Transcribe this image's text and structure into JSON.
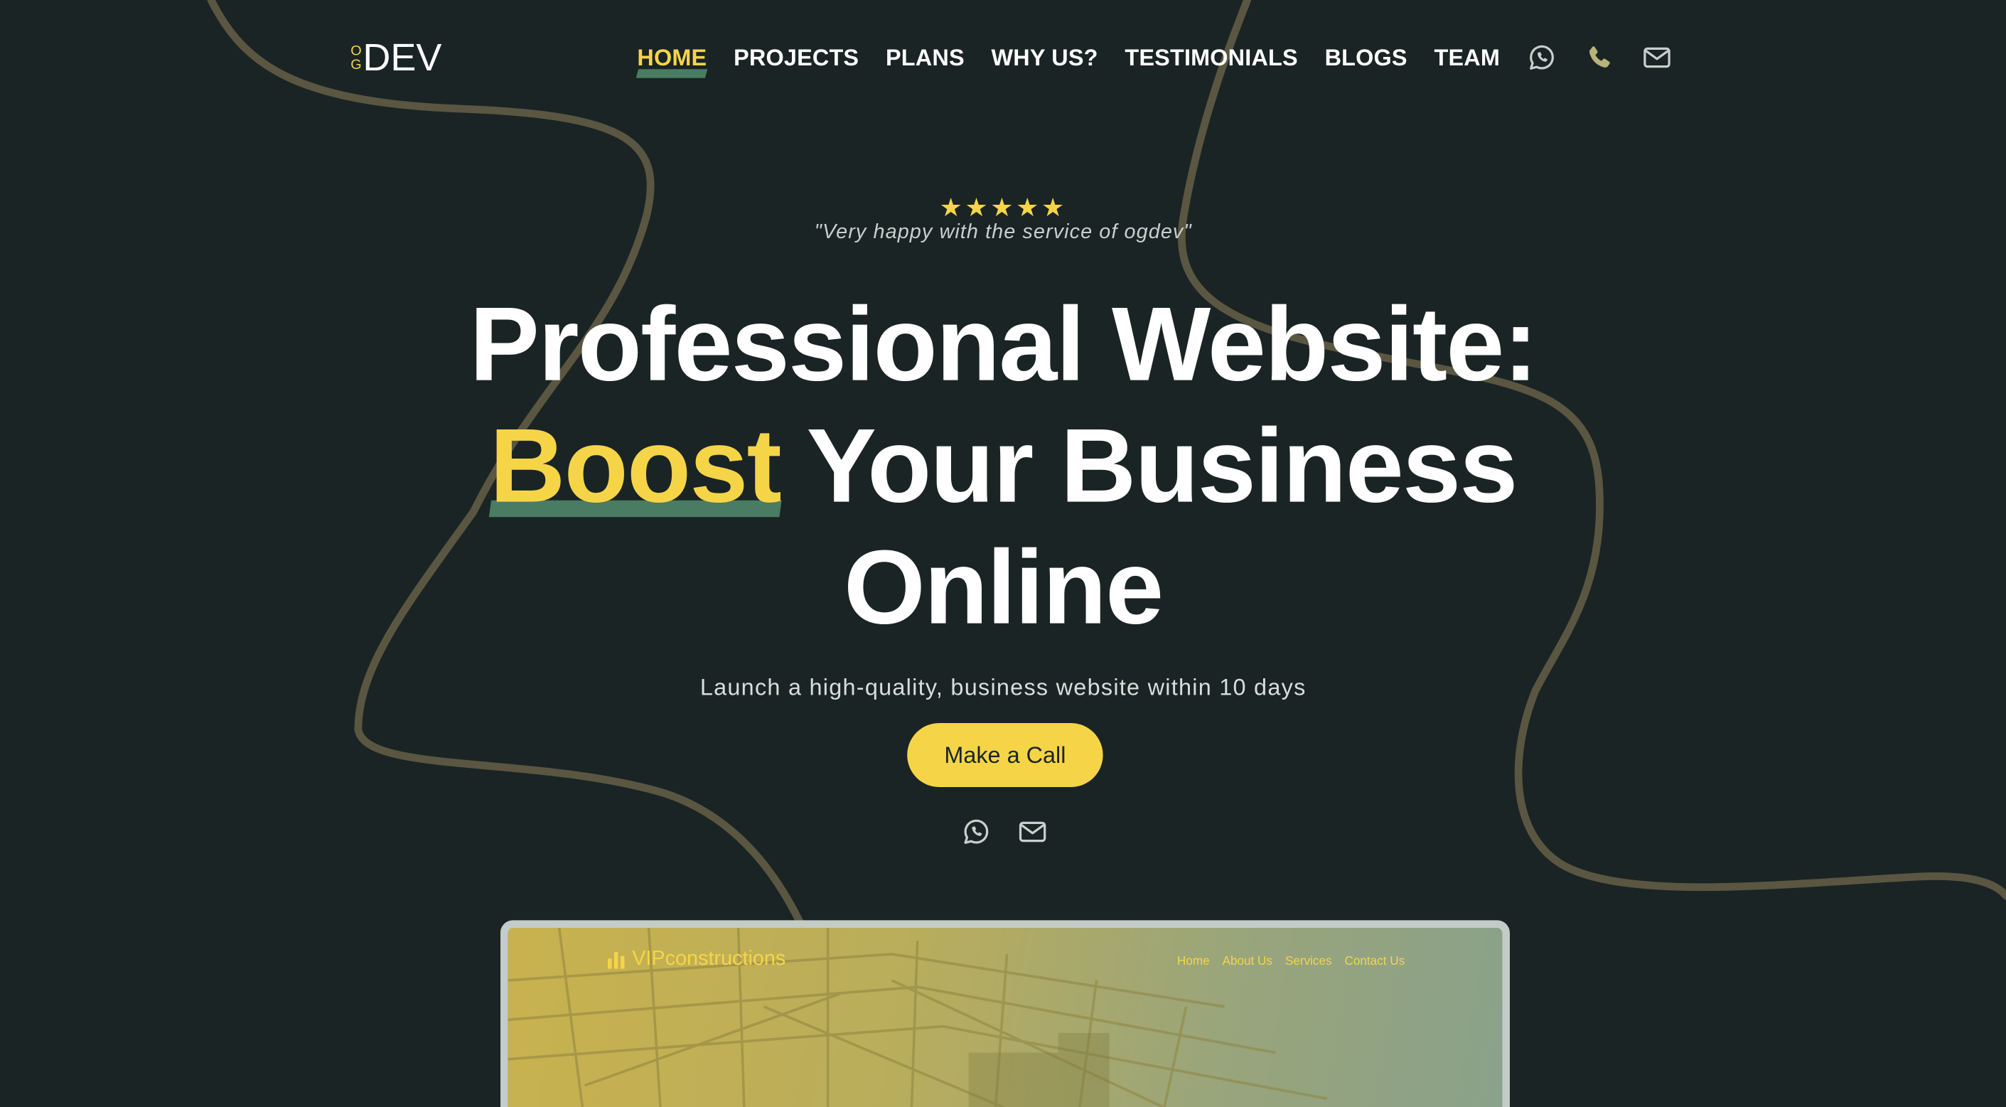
{
  "logo": {
    "og_top": "O",
    "og_bottom": "G",
    "dev": "DEV"
  },
  "nav": {
    "items": [
      {
        "label": "HOME",
        "active": true
      },
      {
        "label": "PROJECTS",
        "active": false
      },
      {
        "label": "PLANS",
        "active": false
      },
      {
        "label": "WHY US?",
        "active": false
      },
      {
        "label": "TESTIMONIALS",
        "active": false
      },
      {
        "label": "BLOGS",
        "active": false
      },
      {
        "label": "TEAM",
        "active": false
      }
    ],
    "icons": [
      "whatsapp-icon",
      "phone-icon",
      "mail-icon"
    ]
  },
  "hero": {
    "rating": 5,
    "stars": "★★★★★",
    "quote": "\"Very happy with the service of ogdev\"",
    "headline_line1": "Professional Website:",
    "headline_highlight": "Boost",
    "headline_line2_rest": " Your Business",
    "headline_line3": "Online",
    "subtitle": "Launch a high-quality, business website within 10 days",
    "cta_label": "Make a Call",
    "contact_icons": [
      "whatsapp-icon",
      "mail-icon"
    ]
  },
  "preview": {
    "brand": "VIPconstructions",
    "nav": [
      "Home",
      "About Us",
      "Services",
      "Contact Us"
    ]
  },
  "colors": {
    "background": "#1a2424",
    "accent_yellow": "#f5d547",
    "accent_green": "#4a7b63",
    "swirl": "#5a5642",
    "text": "#ffffff"
  }
}
